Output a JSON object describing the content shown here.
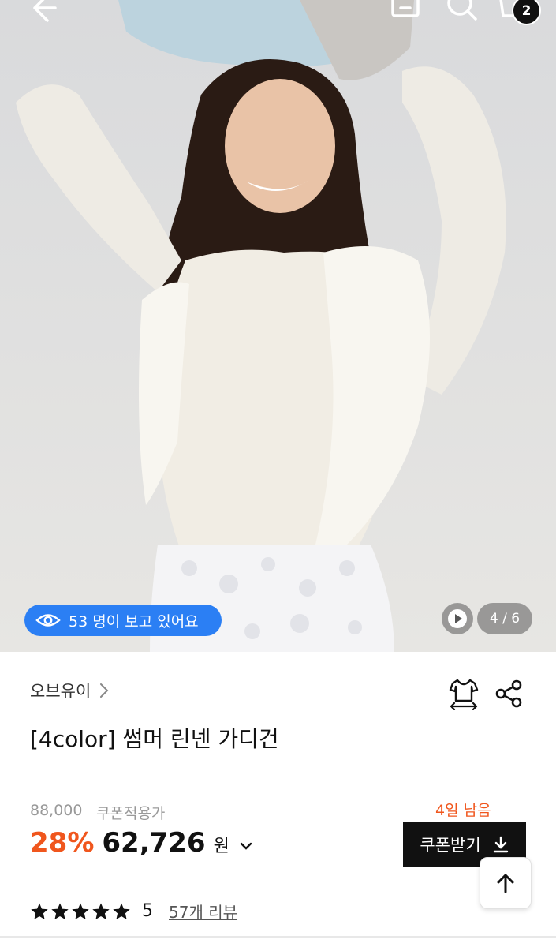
{
  "header": {
    "back_icon": "back-arrow-icon",
    "bookmark_icon": "bookmark-icon",
    "search_icon": "search-icon",
    "cart_icon": "cart-icon",
    "cart_count": "2"
  },
  "gallery": {
    "viewers_text": "53 명이 보고 있어요",
    "page_indicator": "4 / 6",
    "video_icon": "play-icon"
  },
  "product": {
    "brand": "오브유이",
    "title": "[4color] 썸머 린넨 가디건",
    "original_price": "88,000",
    "coupon_label": "쿠폰적용가",
    "discount": "28%",
    "price": "62,726",
    "currency": "원",
    "days_left": "4일 남음",
    "coupon_button": "쿠폰받기",
    "rating": "5",
    "rating_stars": 5,
    "review_link": "57개 리뷰"
  },
  "colors": {
    "accent_blue": "#2b7ff4",
    "discount_orange": "#f0561d",
    "button_black": "#111111"
  }
}
